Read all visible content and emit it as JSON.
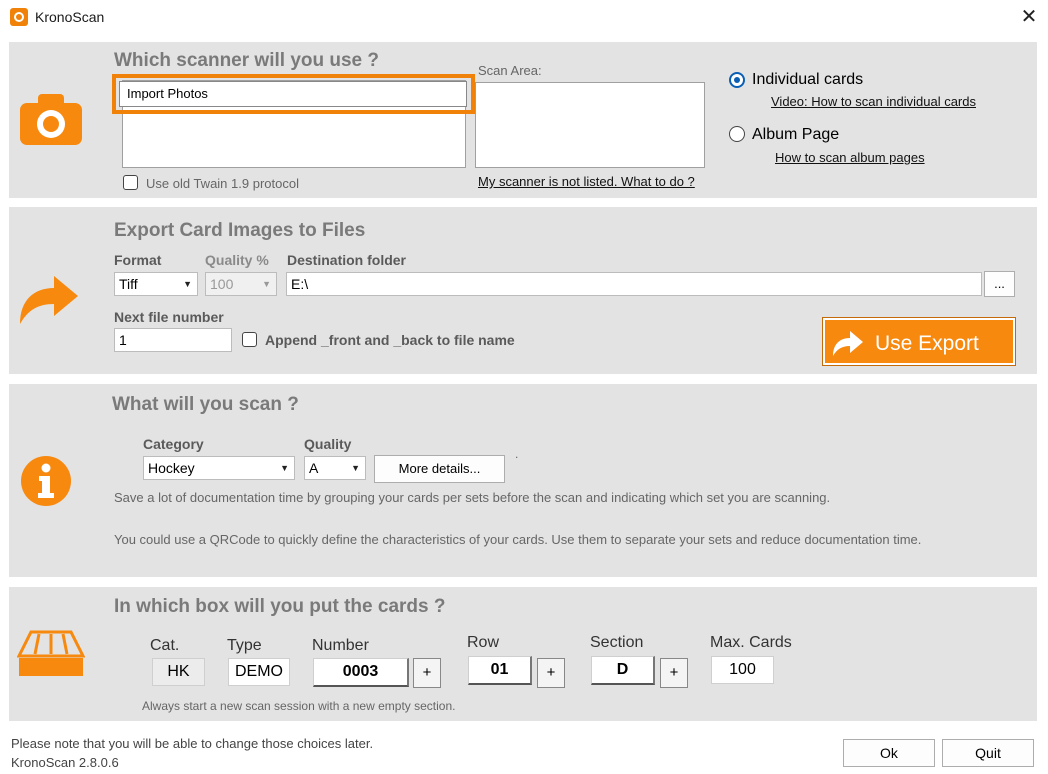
{
  "window": {
    "title": "KronoScan",
    "close_glyph": "✕"
  },
  "scanner": {
    "heading": "Which scanner will you use ?",
    "selected_scanner": "Import Photos",
    "scan_area_label": "Scan Area:",
    "twain_label": "Use old Twain 1.9 protocol",
    "not_listed_link": "My scanner is not listed. What to do ?",
    "mode_individual": "Individual cards",
    "mode_individual_link": "Video: How to scan individual cards",
    "mode_album": "Album Page",
    "mode_album_link": "How to scan album pages",
    "selected_mode": "individual"
  },
  "export": {
    "heading": "Export Card Images to Files",
    "format_label": "Format",
    "format_value": "Tiff",
    "quality_label": "Quality %",
    "quality_value": "100",
    "destination_label": "Destination folder",
    "destination_value": "E:\\",
    "browse_label": "...",
    "next_file_label": "Next file number",
    "next_file_value": "1",
    "append_label": "Append _front and _back to file name",
    "use_export_label": "Use Export"
  },
  "scan_what": {
    "heading": "What will you scan ?",
    "category_label": "Category",
    "category_value": "Hockey",
    "quality_label": "Quality",
    "quality_value": "A",
    "more_details_label": "More details...",
    "dot": ".",
    "info_line_1": "Save a lot of documentation time by grouping your cards per sets before the scan and indicating which set you are scanning.",
    "info_line_2": "You could use a QRCode to quickly define the characteristics of your cards. Use them to separate your sets and reduce documentation time."
  },
  "box": {
    "heading": "In which box will you put the cards ?",
    "cat_label": "Cat.",
    "cat_value": "HK",
    "type_label": "Type",
    "type_value": "DEMO",
    "number_label": "Number",
    "number_value": "0003",
    "row_label": "Row",
    "row_value": "01",
    "section_label": "Section",
    "section_value": "D",
    "max_label": "Max. Cards",
    "max_value": "100",
    "plus_glyph": "+",
    "note": "Always start a new scan session with a new empty section."
  },
  "footer": {
    "note": "Please note that you will be able to change those choices later.",
    "version": "KronoScan 2.8.0.6",
    "ok_label": "Ok",
    "quit_label": "Quit"
  },
  "colors": {
    "accent": "#f7890f",
    "panel": "#e3e3e3",
    "radio_selected": "#0a5fb4"
  },
  "icons": {
    "app": "kronoscan-logo-icon",
    "scanner_section": "camera-icon",
    "export_section": "share-arrow-icon",
    "info_section": "info-icon",
    "box_section": "card-box-icon"
  }
}
